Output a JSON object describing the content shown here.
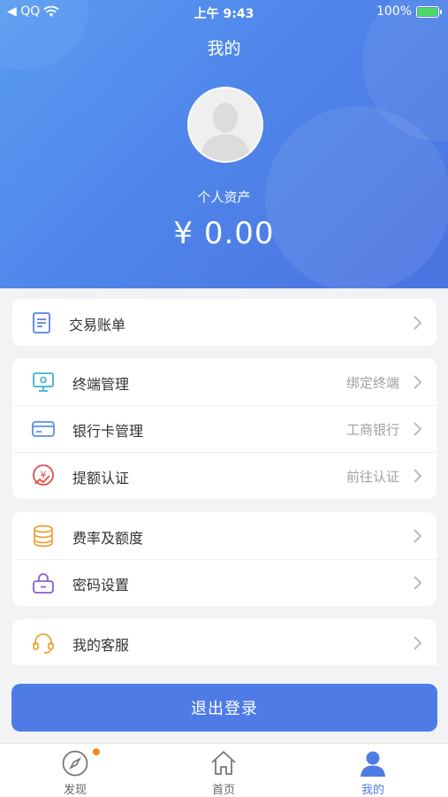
{
  "status_bar": {
    "carrier": "◀ QQ",
    "time": "上午 9:43",
    "battery": "100%"
  },
  "header": {
    "title": "我的",
    "asset_label": "个人资产",
    "asset_value": "¥ 0.00"
  },
  "menu": {
    "bill": {
      "label": "交易账单",
      "icon": "document-icon"
    },
    "terminal": {
      "label": "终端管理",
      "value": "绑定终端",
      "icon": "monitor-icon"
    },
    "bank_card": {
      "label": "银行卡管理",
      "value": "工商银行",
      "icon": "card-icon"
    },
    "limit_cert": {
      "label": "提额认证",
      "value": "前往认证",
      "icon": "yen-chart-icon"
    },
    "rate": {
      "label": "费率及额度",
      "icon": "coins-icon"
    },
    "password": {
      "label": "密码设置",
      "icon": "lock-icon"
    },
    "service": {
      "label": "我的客服",
      "icon": "headset-icon"
    }
  },
  "logout_label": "退出登录",
  "tabs": {
    "discover": {
      "label": "发现",
      "icon": "compass-icon",
      "badge": true
    },
    "home": {
      "label": "首页",
      "icon": "home-icon"
    },
    "mine": {
      "label": "我的",
      "icon": "user-icon",
      "active": true
    }
  },
  "colors": {
    "accent": "#4e7be6",
    "header_gradient_start": "#5a9cf2",
    "header_gradient_end": "#4a73e0",
    "badge": "#f08a24"
  }
}
